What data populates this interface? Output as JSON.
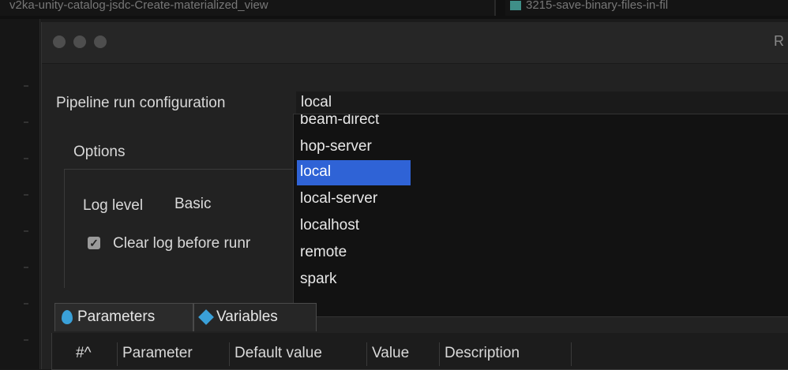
{
  "top_tabs": {
    "left": "v2ka-unity-catalog-jsdc-Create-materialized_view",
    "right": "3215-save-binary-files-in-fil"
  },
  "dialog": {
    "title_fragment": "R",
    "run_config_label": "Pipeline run configuration",
    "run_config_value": "local",
    "options_label": "Options",
    "log_level_label": "Log level",
    "log_level_value": "Basic",
    "clear_log_label": "Clear log before runr",
    "clear_log_checked": true
  },
  "dropdown": {
    "items": [
      "beam-direct",
      "hop-server",
      "local",
      "local-server",
      "localhost",
      "remote",
      "spark"
    ],
    "selected": "local"
  },
  "bottom_tabs": [
    {
      "label": "Parameters",
      "icon": "drop-icon"
    },
    {
      "label": "Variables",
      "icon": "diamond-icon"
    }
  ],
  "table_headers": [
    "#^",
    "Parameter",
    "Default value",
    "Value",
    "Description"
  ],
  "colors": {
    "selection": "#2f63d6",
    "accent_icon": "#3aa0d8",
    "background": "#222222"
  }
}
